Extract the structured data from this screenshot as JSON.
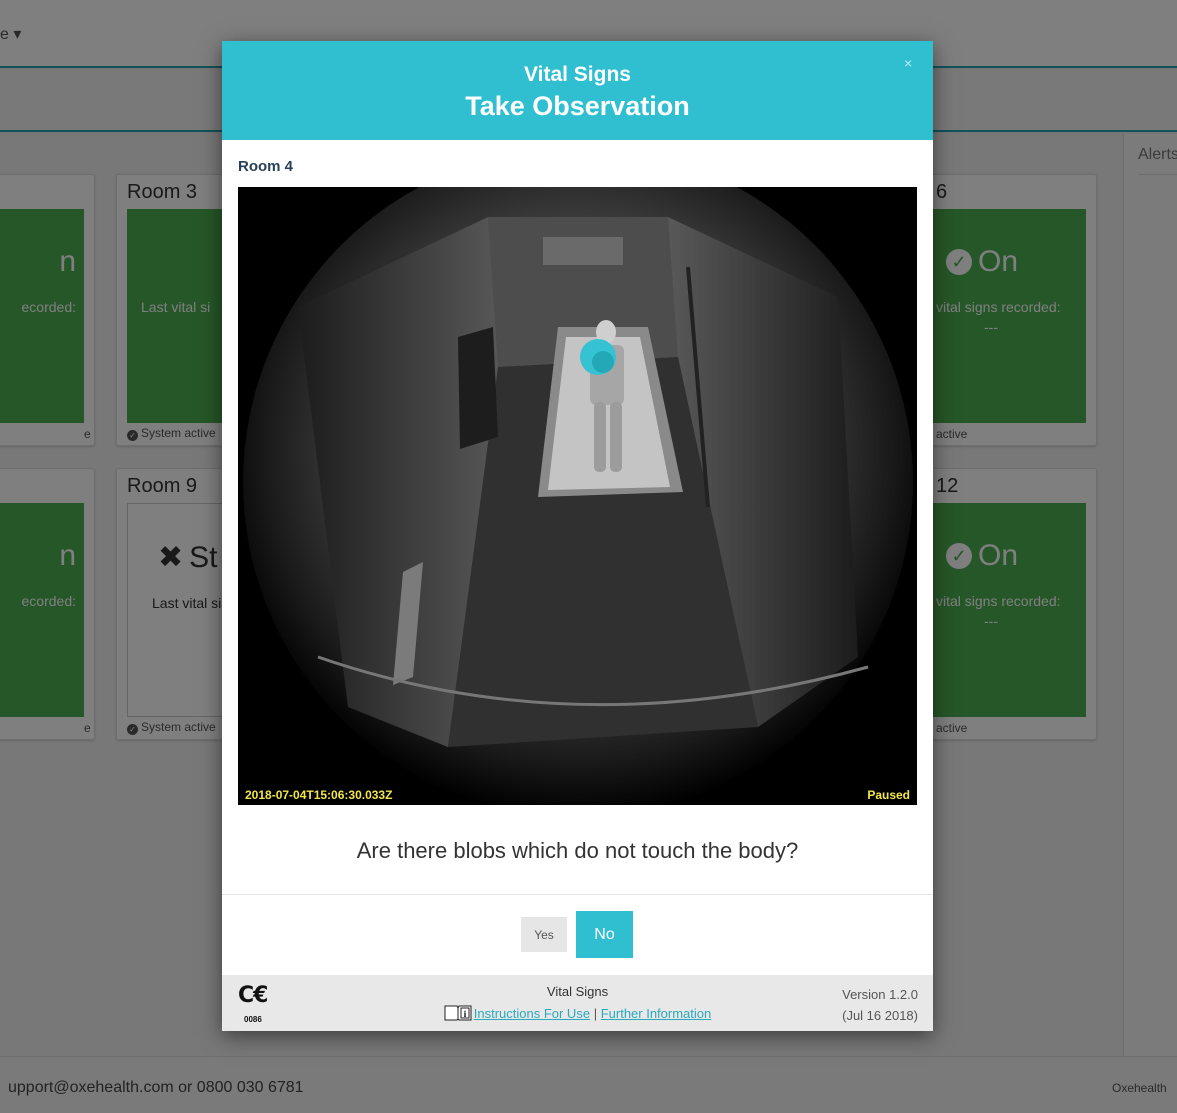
{
  "background": {
    "nav_menu_label": "e ▾",
    "alerts_title": "Alerts",
    "cards": [
      {
        "room": "",
        "status": "on",
        "big_text": "n",
        "last_label": "ecorded:",
        "dashes": "",
        "system": "e"
      },
      {
        "room": "Room 3",
        "status": "on",
        "big_text": "",
        "last_label": "Last vital si",
        "dashes": "",
        "system": "System active"
      },
      {
        "room": "6",
        "status": "on",
        "big_text": "On",
        "last_label": "vital signs recorded:",
        "dashes": "---",
        "system": "active"
      },
      {
        "room": "",
        "status": "on",
        "big_text": "n",
        "last_label": "ecorded:",
        "dashes": "",
        "system": "e"
      },
      {
        "room": "Room 9",
        "status": "stopped",
        "big_text": "St",
        "last_label": "Last vital si",
        "dashes": "",
        "system": "System active"
      },
      {
        "room": "12",
        "status": "on",
        "big_text": "On",
        "last_label": "vital signs recorded:",
        "dashes": "---",
        "system": "active"
      }
    ],
    "footer_support": "upport@oxehealth.com or 0800 030 6781",
    "footer_company": "Oxehealth"
  },
  "modal": {
    "app_name": "Vital Signs",
    "title": "Take Observation",
    "close_symbol": "×",
    "room": "Room 4",
    "video": {
      "timestamp": "2018-07-04T15:06:30.033Z",
      "state": "Paused"
    },
    "question": "Are there blobs which do not touch the body?",
    "buttons": {
      "yes": "Yes",
      "no": "No"
    },
    "footer": {
      "ce_mark": "C€",
      "ce_number": "0086",
      "app_name": "Vital Signs",
      "link_instructions": "Instructions For Use",
      "separator": "|",
      "link_further": "Further Information",
      "version": "Version 1.2.0",
      "date": "(Jul 16 2018)"
    }
  },
  "colors": {
    "accent": "#30bfd0",
    "status_green": "#4caf50",
    "timestamp_yellow": "#f3e64a"
  }
}
